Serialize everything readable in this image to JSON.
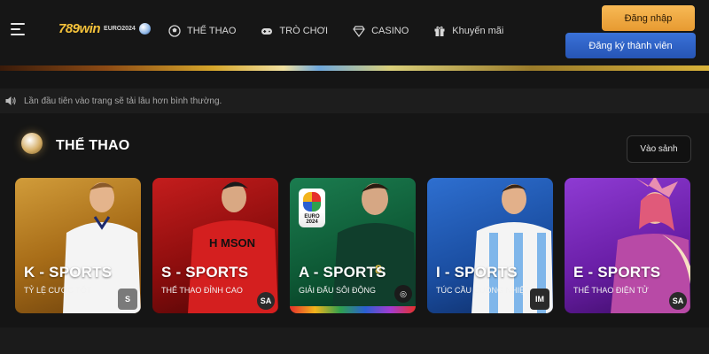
{
  "header": {
    "logo_text": "789win",
    "euro_badge": "EURO2024",
    "nav": [
      {
        "label": "THỂ THAO",
        "icon": "soccer-ball-icon"
      },
      {
        "label": "TRÒ CHƠI",
        "icon": "gamepad-icon"
      },
      {
        "label": "CASINO",
        "icon": "diamond-icon"
      },
      {
        "label": "Khuyến mãi",
        "icon": "gift-icon"
      }
    ],
    "login_label": "Đăng nhập",
    "register_label": "Đăng ký thành viên"
  },
  "notice": {
    "text": "Lần đầu tiên vào trang sẽ tải lâu hơn bình thường.",
    "icon": "speaker-icon"
  },
  "section": {
    "title": "THỂ THAO",
    "lobby_label": "Vào sảnh"
  },
  "cards": [
    {
      "name": "K - SPORTS",
      "tagline": "TỶ LỆ CƯỢC TỐT",
      "brand": "S"
    },
    {
      "name": "S - SPORTS",
      "tagline": "THỂ THAO ĐỈNH CAO",
      "brand": "SA"
    },
    {
      "name": "A - SPORTS",
      "tagline": "GIẢI ĐẤU SÔI ĐỘNG",
      "brand": "◎",
      "badge": "EURO 2024"
    },
    {
      "name": "I - SPORTS",
      "tagline": "TÚC CẦU CUỒNG NHIỆT",
      "brand": "IM"
    },
    {
      "name": "E - SPORTS",
      "tagline": "THỂ THAO ĐIỆN TỬ",
      "brand": "SA"
    }
  ],
  "colors": {
    "login": "#f0a843",
    "register": "#2f63c8",
    "background": "#151515"
  }
}
